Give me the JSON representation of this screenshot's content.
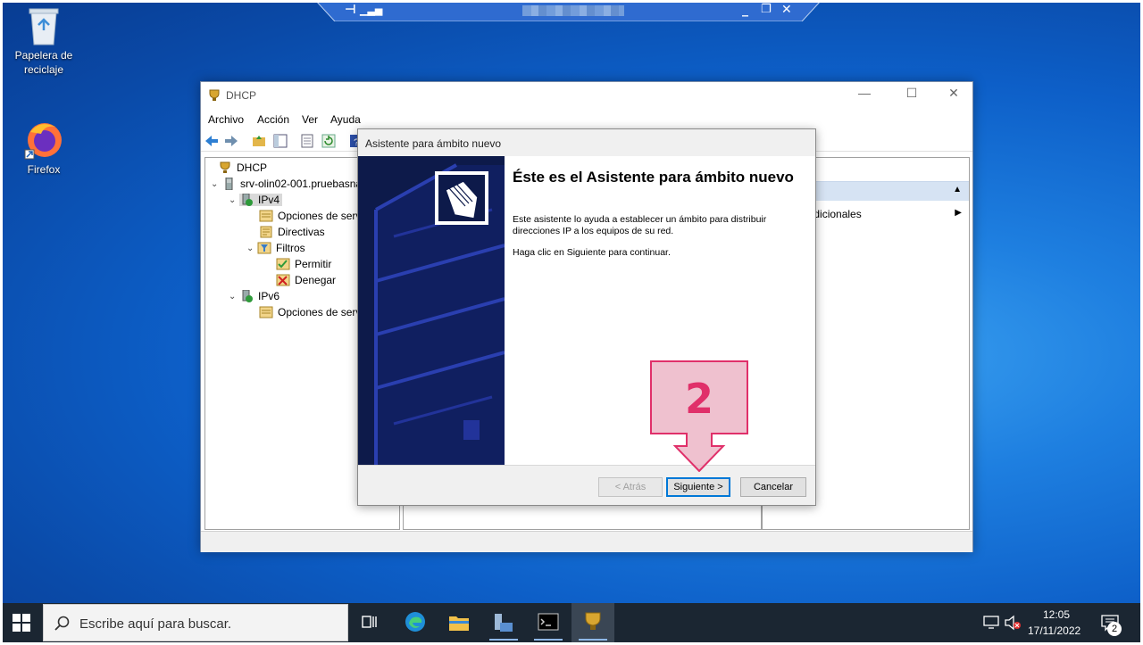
{
  "desktop": {
    "icons": [
      {
        "label": "Papelera de reciclaje"
      },
      {
        "label": "Firefox"
      }
    ]
  },
  "dhcp_window": {
    "title": "DHCP",
    "menu": [
      "Archivo",
      "Acción",
      "Ver",
      "Ayuda"
    ],
    "tree": [
      {
        "label": "DHCP"
      },
      {
        "label": "srv-olin02-001.pruebasna"
      },
      {
        "label": "IPv4"
      },
      {
        "label": "Opciones de serv"
      },
      {
        "label": "Directivas"
      },
      {
        "label": "Filtros"
      },
      {
        "label": "Permitir"
      },
      {
        "label": "Denegar"
      },
      {
        "label": "IPv6"
      },
      {
        "label": "Opciones de serv"
      }
    ],
    "actions_item": "nes adicionales"
  },
  "wizard": {
    "title": "Asistente para ámbito nuevo",
    "heading": "Éste es el Asistente para ámbito nuevo",
    "paragraph1": "Este asistente lo ayuda a establecer un ámbito para distribuir direcciones IP a los equipos de su red.",
    "paragraph2": "Haga clic en Siguiente para continuar.",
    "back_label": "< Atrás",
    "next_label": "Siguiente >",
    "cancel_label": "Cancelar"
  },
  "callout": {
    "number": "2",
    "color": "#e0306a"
  },
  "taskbar": {
    "search_placeholder": "Escribe aquí para buscar.",
    "time": "12:05",
    "date": "17/11/2022",
    "notification_count": "2"
  },
  "colors": {
    "wizard_side": "#0d1a4a",
    "accent": "#0078d7"
  }
}
